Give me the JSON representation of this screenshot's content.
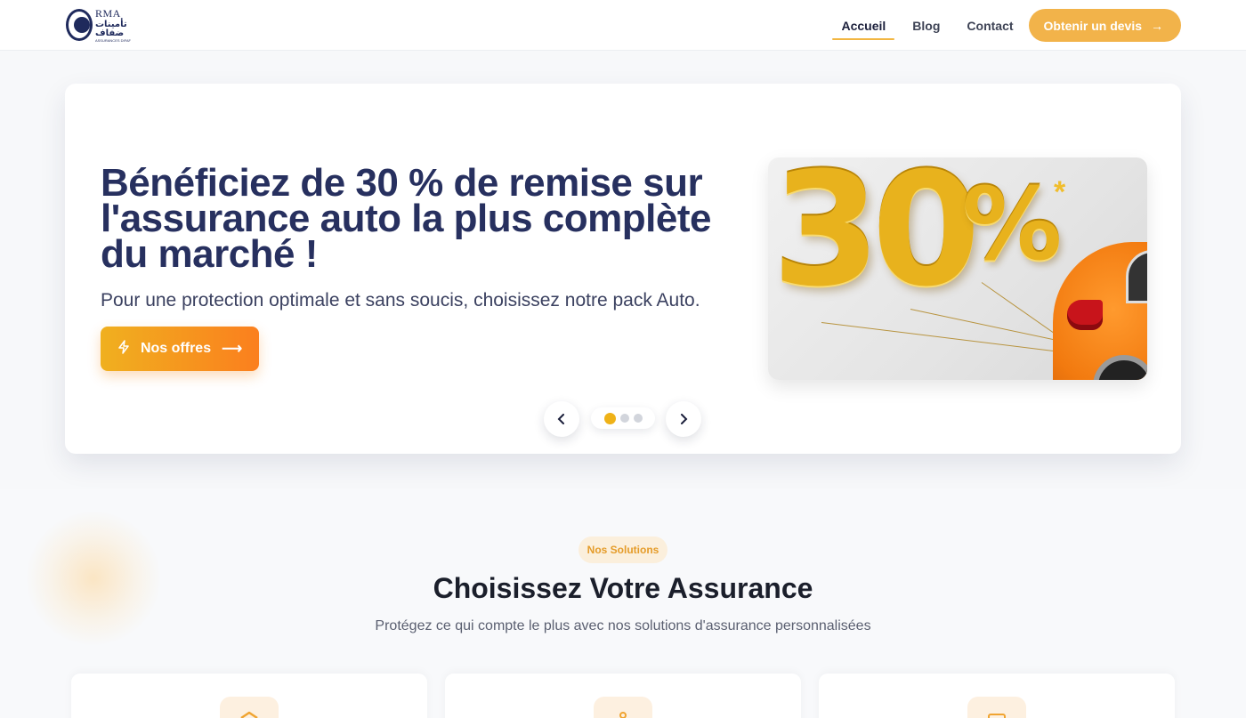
{
  "header": {
    "logo": {
      "brand": "RMA",
      "arabic": "تأمينات ضفاف",
      "sub": "ASSURANCES DIFAF"
    },
    "nav": [
      {
        "label": "Accueil",
        "active": true
      },
      {
        "label": "Blog",
        "active": false
      },
      {
        "label": "Contact",
        "active": false
      }
    ],
    "cta": {
      "label": "Obtenir un devis",
      "icon": "arrow-right-icon"
    }
  },
  "hero": {
    "title": "Bénéficiez de 30 % de remise sur l'assurance auto la plus complète du marché !",
    "subtitle": "Pour une protection optimale et sans soucis, choisissez notre pack Auto.",
    "button": {
      "label": "Nos offres",
      "icon_left": "lightning-icon",
      "icon_right": "arrow-right-icon"
    },
    "image": {
      "text": "30%",
      "star": "*"
    },
    "slider": {
      "slide_count": 3,
      "active_index": 0
    }
  },
  "solutions": {
    "badge": "Nos Solutions",
    "title": "Choisissez Votre Assurance",
    "subtitle": "Protégez ce qui compte le plus avec nos solutions d'assurance personnalisées",
    "cards": [
      {
        "icon": "shield-icon"
      },
      {
        "icon": "pin-icon"
      },
      {
        "icon": "document-icon"
      }
    ]
  },
  "colors": {
    "accent": "#f2b34a",
    "navy": "#27305f",
    "orange": "#fb7f1e"
  }
}
